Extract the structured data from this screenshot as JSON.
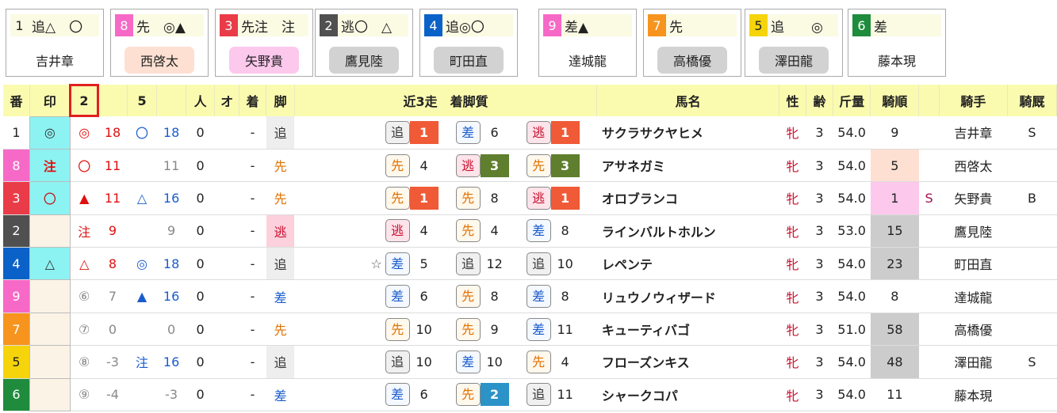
{
  "cards": [
    {
      "num": "1",
      "marks": "追△　〇",
      "name": "吉井章",
      "num_bg": "#ffffff",
      "num_fg": "#222222",
      "name_bg": "#ffffff"
    },
    {
      "num": "8",
      "marks": "先　◎▲",
      "name": "西啓太",
      "num_bg": "#f669c6",
      "num_fg": "#ffffff",
      "name_bg": "#fde0d2"
    },
    {
      "num": "3",
      "marks": "先注　注",
      "name": "矢野貴",
      "num_bg": "#e93c48",
      "num_fg": "#ffffff",
      "name_bg": "#fcc8ec"
    },
    {
      "num": "2",
      "marks": "逃〇　△",
      "name": "鷹見陸",
      "num_bg": "#505050",
      "num_fg": "#ffffff",
      "name_bg": "#d2d2d2"
    },
    {
      "num": "4",
      "marks": "追◎〇",
      "name": "町田直",
      "num_bg": "#0a62c8",
      "num_fg": "#ffffff",
      "name_bg": "#d2d2d2"
    },
    {
      "num": "9",
      "marks": "差▲",
      "name": "達城龍",
      "num_bg": "#f669c6",
      "num_fg": "#ffffff",
      "name_bg": "#ffffff"
    },
    {
      "num": "7",
      "marks": "先",
      "name": "高橋優",
      "num_bg": "#f7941e",
      "num_fg": "#ffffff",
      "name_bg": "#d2d2d2"
    },
    {
      "num": "5",
      "marks": "追　　◎",
      "name": "澤田龍",
      "num_bg": "#f5d40c",
      "num_fg": "#222222",
      "name_bg": "#d2d2d2"
    },
    {
      "num": "6",
      "marks": "差",
      "name": "藤本現",
      "num_bg": "#1e8c3c",
      "num_fg": "#ffffff",
      "name_bg": "#ffffff"
    }
  ],
  "headers": {
    "ban": "番",
    "shirushi": "印",
    "col2": "2",
    "col3": "",
    "col5": "5",
    "col6": "",
    "ninki": "人",
    "o": "オ",
    "chaku": "着",
    "kyaku": "脚",
    "kin3": "近3走　着脚質",
    "bamei": "馬名",
    "sei": "性",
    "rei": "齢",
    "kinryo": "斤量",
    "kijun": "騎順",
    "blank": "",
    "kishu": "騎手",
    "kirei": "騎厩"
  },
  "rows": [
    {
      "ban": "1",
      "shirushi": "◎",
      "m1": "◎",
      "v1": "18",
      "m2": "〇",
      "v2": "18",
      "ninki": "0",
      "o": "",
      "chaku": "-",
      "kyaku": "追",
      "runs": [
        {
          "st": "追",
          "pos": "1",
          "star": ""
        },
        {
          "st": "差",
          "pos": "6",
          "star": ""
        },
        {
          "st": "逃",
          "pos": "1",
          "star": ""
        }
      ],
      "bamei": "サクラサクヤヒメ",
      "sei": "牝",
      "rei": "3",
      "kinryo": "54.0",
      "kijun": "9",
      "s": "",
      "kishu": "吉井章",
      "kirei": "S"
    },
    {
      "ban": "8",
      "shirushi": "注",
      "m1": "〇",
      "v1": "11",
      "m2": "",
      "v2": "11",
      "ninki": "0",
      "o": "",
      "chaku": "-",
      "kyaku": "先",
      "runs": [
        {
          "st": "先",
          "pos": "4",
          "star": ""
        },
        {
          "st": "逃",
          "pos": "3",
          "star": ""
        },
        {
          "st": "先",
          "pos": "3",
          "star": ""
        }
      ],
      "bamei": "アサネガミ",
      "sei": "牝",
      "rei": "3",
      "kinryo": "54.0",
      "kijun": "5",
      "s": "",
      "kishu": "西啓太",
      "kirei": ""
    },
    {
      "ban": "3",
      "shirushi": "〇",
      "m1": "▲",
      "v1": "11",
      "m2": "△",
      "v2": "16",
      "ninki": "0",
      "o": "",
      "chaku": "-",
      "kyaku": "先",
      "runs": [
        {
          "st": "先",
          "pos": "1",
          "star": ""
        },
        {
          "st": "先",
          "pos": "8",
          "star": ""
        },
        {
          "st": "逃",
          "pos": "1",
          "star": ""
        }
      ],
      "bamei": "オロブランコ",
      "sei": "牝",
      "rei": "3",
      "kinryo": "54.0",
      "kijun": "1",
      "s": "S",
      "kishu": "矢野貴",
      "kirei": "B"
    },
    {
      "ban": "2",
      "shirushi": "",
      "m1": "注",
      "v1": "9",
      "m2": "",
      "v2": "9",
      "ninki": "0",
      "o": "",
      "chaku": "-",
      "kyaku": "逃",
      "runs": [
        {
          "st": "逃",
          "pos": "4",
          "star": ""
        },
        {
          "st": "先",
          "pos": "4",
          "star": ""
        },
        {
          "st": "差",
          "pos": "8",
          "star": ""
        }
      ],
      "bamei": "ラインバルトホルン",
      "sei": "牝",
      "rei": "3",
      "kinryo": "53.0",
      "kijun": "15",
      "s": "",
      "kishu": "鷹見陸",
      "kirei": ""
    },
    {
      "ban": "4",
      "shirushi": "△",
      "m1": "△",
      "v1": "8",
      "m2": "◎",
      "v2": "18",
      "ninki": "0",
      "o": "",
      "chaku": "-",
      "kyaku": "追",
      "runs": [
        {
          "st": "差",
          "pos": "5",
          "star": "☆"
        },
        {
          "st": "追",
          "pos": "12",
          "star": ""
        },
        {
          "st": "追",
          "pos": "10",
          "star": ""
        }
      ],
      "bamei": "レペンテ",
      "sei": "牝",
      "rei": "3",
      "kinryo": "54.0",
      "kijun": "23",
      "s": "",
      "kishu": "町田直",
      "kirei": ""
    },
    {
      "ban": "9",
      "shirushi": "",
      "m1": "⑥",
      "v1": "7",
      "m2": "▲",
      "v2": "16",
      "ninki": "0",
      "o": "",
      "chaku": "-",
      "kyaku": "差",
      "runs": [
        {
          "st": "差",
          "pos": "6",
          "star": ""
        },
        {
          "st": "先",
          "pos": "8",
          "star": ""
        },
        {
          "st": "差",
          "pos": "8",
          "star": ""
        }
      ],
      "bamei": "リュウノウィザード",
      "sei": "牝",
      "rei": "3",
      "kinryo": "54.0",
      "kijun": "8",
      "s": "",
      "kishu": "達城龍",
      "kirei": ""
    },
    {
      "ban": "7",
      "shirushi": "",
      "m1": "⑦",
      "v1": "0",
      "m2": "",
      "v2": "0",
      "ninki": "0",
      "o": "",
      "chaku": "-",
      "kyaku": "先",
      "runs": [
        {
          "st": "先",
          "pos": "10",
          "star": ""
        },
        {
          "st": "先",
          "pos": "9",
          "star": ""
        },
        {
          "st": "差",
          "pos": "11",
          "star": ""
        }
      ],
      "bamei": "キューティバゴ",
      "sei": "牝",
      "rei": "3",
      "kinryo": "51.0",
      "kijun": "58",
      "s": "",
      "kishu": "高橋優",
      "kirei": ""
    },
    {
      "ban": "5",
      "shirushi": "",
      "m1": "⑧",
      "v1": "-3",
      "m2": "注",
      "v2": "16",
      "ninki": "0",
      "o": "",
      "chaku": "-",
      "kyaku": "追",
      "runs": [
        {
          "st": "追",
          "pos": "10",
          "star": ""
        },
        {
          "st": "差",
          "pos": "10",
          "star": ""
        },
        {
          "st": "先",
          "pos": "4",
          "star": ""
        }
      ],
      "bamei": "フローズンキス",
      "sei": "牝",
      "rei": "3",
      "kinryo": "54.0",
      "kijun": "48",
      "s": "",
      "kishu": "澤田龍",
      "kirei": "S"
    },
    {
      "ban": "6",
      "shirushi": "",
      "m1": "⑨",
      "v1": "-4",
      "m2": "",
      "v2": "-3",
      "ninki": "0",
      "o": "",
      "chaku": "-",
      "kyaku": "差",
      "runs": [
        {
          "st": "差",
          "pos": "6",
          "star": ""
        },
        {
          "st": "先",
          "pos": "2",
          "star": ""
        },
        {
          "st": "追",
          "pos": "11",
          "star": ""
        }
      ],
      "bamei": "シャークコパ",
      "sei": "牝",
      "rei": "3",
      "kinryo": "54.0",
      "kijun": "11",
      "s": "",
      "kishu": "藤本現",
      "kirei": ""
    }
  ],
  "colors": {
    "ban_bg": [
      "#ffffff",
      "#f669c6",
      "#e93c48",
      "#505050",
      "#0a62c8",
      "#f669c6",
      "#f7941e",
      "#f5d40c",
      "#1e8c3c"
    ],
    "ban_fg": [
      "#222222",
      "#ffffff",
      "#ffffff",
      "#ffffff",
      "#ffffff",
      "#ffffff",
      "#ffffff",
      "#222222",
      "#ffffff"
    ],
    "shirushi_bg": [
      "#8df2f2",
      "#8df2f2",
      "#8df2f2",
      "#fbf3e6",
      "#8df2f2",
      "#fbf3e6",
      "#fbf3e6",
      "#fbf3e6",
      "#fbf3e6"
    ],
    "kijun_bg": [
      "#ffffff",
      "#fde0d2",
      "#fcc8ec",
      "#cccccc",
      "#cccccc",
      "#ffffff",
      "#cccccc",
      "#cccccc",
      "#ffffff"
    ],
    "kyaku_bg": [
      "#eeeeee",
      "#ffffff",
      "#ffffff",
      "#fcd0dc",
      "#eeeeee",
      "#ffffff",
      "#ffffff",
      "#eeeeee",
      "#ffffff"
    ],
    "style_fg": {
      "追": "#333333",
      "差": "#1a5ccc",
      "先": "#e07000",
      "逃": "#c8102e"
    },
    "style_bg": {
      "追": "#f0f0f0",
      "差": "#f4f8ff",
      "先": "#fff8ec",
      "逃": "#fde3ea"
    },
    "pos_bg": {
      "1": "#f05a36",
      "2": "#2b93c7",
      "3": "#5f7e2e"
    },
    "mark_red": "#e01010",
    "mark_blue": "#1a5ccc",
    "header_bg": "#fbfbb0"
  }
}
